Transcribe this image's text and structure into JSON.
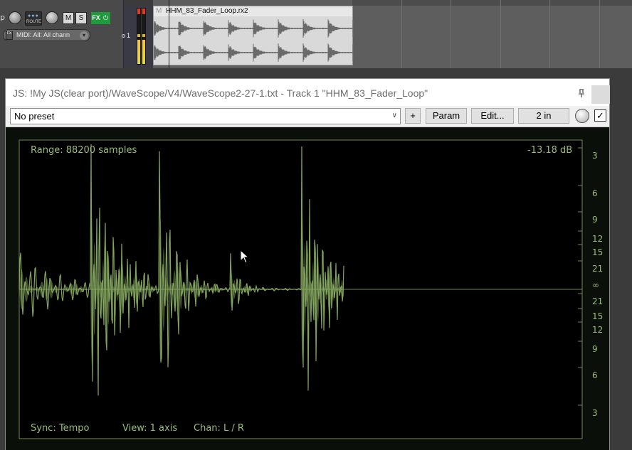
{
  "track": {
    "name_fragment": "p",
    "route_label": "ROUTE",
    "mute_label": "M",
    "solo_label": "S",
    "fx_label": "FX",
    "power_label": "⏻",
    "midi_fx": "FX",
    "midi_input": "MIDI: All: All chann",
    "track_number": "1"
  },
  "item": {
    "m_label": "M",
    "name": "HHM_83_Fader_Loop.rx2"
  },
  "plugin": {
    "title": "JS: !My JS(clear port)/WaveScope/V4/WaveScope2-27-1.txt - Track 1 \"HHM_83_Fader_Loop\"",
    "preset": "No preset",
    "plus_label": "+",
    "param_label": "Param",
    "edit_label": "Edit...",
    "io_label": "2 in",
    "bypass_checked": true
  },
  "scope": {
    "range_text": "Range: 88200 samples",
    "db_text": "-13.18 dB",
    "sync_text": "Sync:  Tempo",
    "view_text": "View:  1 axis",
    "chan_text": "Chan:  L / R",
    "y_ticks_upper": [
      "3",
      "6",
      "9",
      "12",
      "15",
      "21"
    ],
    "y_center": "∞",
    "y_ticks_lower": [
      "21",
      "15",
      "12",
      "9",
      "6",
      "3"
    ],
    "colors": {
      "wave": "#8aac63",
      "frame": "#6f8a52",
      "text": "#9dbb78",
      "background": "#0b0f0a"
    }
  },
  "icons": {
    "pin": "pin-icon",
    "dropdown": "chevron-down-icon",
    "cursor": "mouse-pointer-icon"
  }
}
